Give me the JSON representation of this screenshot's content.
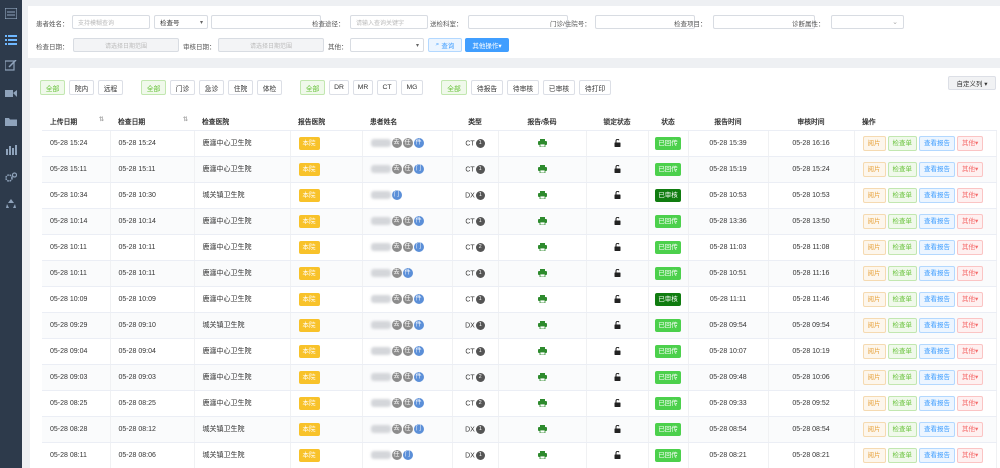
{
  "sidebar": {
    "icons": [
      "list-icon",
      "menu-icon",
      "edit-icon",
      "video-icon",
      "folder-icon",
      "bar-chart-icon",
      "settings-icon",
      "recycle-icon"
    ]
  },
  "filters": {
    "patient_name_label": "患者姓名：",
    "patient_name_placeholder": "支持模糊查询",
    "check_type_value": "检查号",
    "check_route_label": "检查途径：",
    "check_route_placeholder": "请输入查询关键字",
    "referring_dept_label": "送检科室：",
    "outpatient_label": "门诊/住院号：",
    "check_item_label": "检查项目：",
    "diagnosis_attr_label": "诊断属性：",
    "check_date_label": "检查日期：",
    "check_date_placeholder": "请选择日期范围",
    "review_date_label": "审核日期：",
    "review_date_placeholder": "请选择日期范围",
    "other_label": "其他：",
    "search_button": "查询",
    "more_button": "其他操作▾"
  },
  "quick_filters": {
    "group1": [
      "全部",
      "院内",
      "远程"
    ],
    "group2": [
      "全部",
      "门诊",
      "急诊",
      "住院",
      "体检"
    ],
    "group3": [
      "全部",
      "DR",
      "MR",
      "CT",
      "MG"
    ],
    "group4": [
      "全部",
      "待报告",
      "待审核",
      "已审核",
      "待打印"
    ],
    "custom_columns": "自定义列 ▾"
  },
  "table": {
    "headers": [
      "上传日期",
      "检查日期",
      "检查医院",
      "报告医院",
      "患者姓名",
      "类型",
      "报告/条码",
      "锁定状态",
      "状态",
      "报告时间",
      "审核时间",
      "操作"
    ],
    "action_labels": {
      "view": "阅片",
      "request": "检查单",
      "report": "查看报告",
      "other": "其他▾"
    },
    "rows": [
      {
        "upload": "05-28 15:24",
        "check": "05-28 15:24",
        "hospital": "鹿瀍中心卫生院",
        "report_hosp": "本院",
        "tags": [
          "去",
          "任",
          "件"
        ],
        "type": "CT",
        "count": "1",
        "status": "已回传",
        "status_kind": "green",
        "report_time": "05-28 15:39",
        "review_time": "05-28 16:16"
      },
      {
        "upload": "05-28 15:11",
        "check": "05-28 15:11",
        "hospital": "鹿瀍中心卫生院",
        "report_hosp": "本院",
        "tags": [
          "去",
          "任",
          "门"
        ],
        "type": "CT",
        "count": "1",
        "status": "已回传",
        "status_kind": "green",
        "report_time": "05-28 15:19",
        "review_time": "05-28 15:24"
      },
      {
        "upload": "05-28 10:34",
        "check": "05-28 10:30",
        "hospital": "城关镇卫生院",
        "report_hosp": "本院",
        "tags": [
          "门"
        ],
        "type": "DX",
        "count": "1",
        "status": "已审核",
        "status_kind": "dark",
        "report_time": "05-28 10:53",
        "review_time": "05-28 10:53"
      },
      {
        "upload": "05-28 10:14",
        "check": "05-28 10:14",
        "hospital": "鹿瀍中心卫生院",
        "report_hosp": "本院",
        "tags": [
          "去",
          "任",
          "件"
        ],
        "type": "CT",
        "count": "1",
        "status": "已回传",
        "status_kind": "green",
        "report_time": "05-28 13:36",
        "review_time": "05-28 13:50"
      },
      {
        "upload": "05-28 10:11",
        "check": "05-28 10:11",
        "hospital": "鹿瀍中心卫生院",
        "report_hosp": "本院",
        "tags": [
          "去",
          "任",
          "门"
        ],
        "type": "CT",
        "count": "2",
        "status": "已回传",
        "status_kind": "green",
        "report_time": "05-28 11:03",
        "review_time": "05-28 11:08"
      },
      {
        "upload": "05-28 10:11",
        "check": "05-28 10:11",
        "hospital": "鹿瀍中心卫生院",
        "report_hosp": "本院",
        "tags": [
          "去",
          "件"
        ],
        "type": "CT",
        "count": "1",
        "status": "已回传",
        "status_kind": "green",
        "report_time": "05-28 10:51",
        "review_time": "05-28 11:16"
      },
      {
        "upload": "05-28 10:09",
        "check": "05-28 10:09",
        "hospital": "鹿瀍中心卫生院",
        "report_hosp": "本院",
        "tags": [
          "去",
          "任",
          "件"
        ],
        "type": "CT",
        "count": "1",
        "status": "已审核",
        "status_kind": "dark",
        "report_time": "05-28 11:11",
        "review_time": "05-28 11:46"
      },
      {
        "upload": "05-28 09:29",
        "check": "05-28 09:10",
        "hospital": "城关镇卫生院",
        "report_hosp": "本院",
        "tags": [
          "去",
          "任",
          "件"
        ],
        "type": "DX",
        "count": "1",
        "status": "已回传",
        "status_kind": "green",
        "report_time": "05-28 09:54",
        "review_time": "05-28 09:54"
      },
      {
        "upload": "05-28 09:04",
        "check": "05-28 09:04",
        "hospital": "鹿瀍中心卫生院",
        "report_hosp": "本院",
        "tags": [
          "去",
          "任",
          "件"
        ],
        "type": "CT",
        "count": "1",
        "status": "已回传",
        "status_kind": "green",
        "report_time": "05-28 10:07",
        "review_time": "05-28 10:19"
      },
      {
        "upload": "05-28 09:03",
        "check": "05-28 09:03",
        "hospital": "鹿瀍中心卫生院",
        "report_hosp": "本院",
        "tags": [
          "去",
          "任",
          "件"
        ],
        "type": "CT",
        "count": "2",
        "status": "已回传",
        "status_kind": "green",
        "report_time": "05-28 09:48",
        "review_time": "05-28 10:06"
      },
      {
        "upload": "05-28 08:25",
        "check": "05-28 08:25",
        "hospital": "鹿瀍中心卫生院",
        "report_hosp": "本院",
        "tags": [
          "去",
          "任",
          "件"
        ],
        "type": "CT",
        "count": "2",
        "status": "已回传",
        "status_kind": "green",
        "report_time": "05-28 09:33",
        "review_time": "05-28 09:52"
      },
      {
        "upload": "05-28 08:28",
        "check": "05-28 08:12",
        "hospital": "城关镇卫生院",
        "report_hosp": "本院",
        "tags": [
          "去",
          "任",
          "门"
        ],
        "type": "DX",
        "count": "1",
        "status": "已回传",
        "status_kind": "green",
        "report_time": "05-28 08:54",
        "review_time": "05-28 08:54"
      },
      {
        "upload": "05-28 08:11",
        "check": "05-28 08:06",
        "hospital": "城关镇卫生院",
        "report_hosp": "本院",
        "tags": [
          "任",
          "门"
        ],
        "type": "DX",
        "count": "1",
        "status": "已回传",
        "status_kind": "green",
        "report_time": "05-28 08:21",
        "review_time": "05-28 08:21"
      }
    ]
  }
}
